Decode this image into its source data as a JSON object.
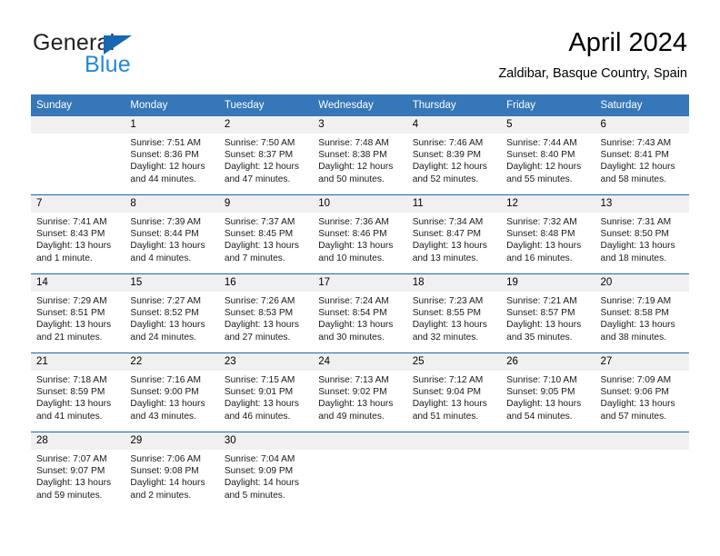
{
  "brand": {
    "name_part1": "General",
    "name_part2": "Blue",
    "logo_icon": "triangle-logo",
    "accent_blue": "#2489d4",
    "logo_blue": "#1668b3"
  },
  "header": {
    "title": "April 2024",
    "subtitle": "Zaldibar, Basque Country, Spain"
  },
  "calendar": {
    "header_bg": "#3577b8",
    "daynum_bg": "#f0f0f0",
    "separator_color": "#1668b3",
    "weekdays": [
      "Sunday",
      "Monday",
      "Tuesday",
      "Wednesday",
      "Thursday",
      "Friday",
      "Saturday"
    ],
    "weeks": [
      [
        {
          "day": "",
          "sunrise": "",
          "sunset": "",
          "daylight1": "",
          "daylight2": "",
          "empty": true
        },
        {
          "day": "1",
          "sunrise": "Sunrise: 7:51 AM",
          "sunset": "Sunset: 8:36 PM",
          "daylight1": "Daylight: 12 hours",
          "daylight2": "and 44 minutes."
        },
        {
          "day": "2",
          "sunrise": "Sunrise: 7:50 AM",
          "sunset": "Sunset: 8:37 PM",
          "daylight1": "Daylight: 12 hours",
          "daylight2": "and 47 minutes."
        },
        {
          "day": "3",
          "sunrise": "Sunrise: 7:48 AM",
          "sunset": "Sunset: 8:38 PM",
          "daylight1": "Daylight: 12 hours",
          "daylight2": "and 50 minutes."
        },
        {
          "day": "4",
          "sunrise": "Sunrise: 7:46 AM",
          "sunset": "Sunset: 8:39 PM",
          "daylight1": "Daylight: 12 hours",
          "daylight2": "and 52 minutes."
        },
        {
          "day": "5",
          "sunrise": "Sunrise: 7:44 AM",
          "sunset": "Sunset: 8:40 PM",
          "daylight1": "Daylight: 12 hours",
          "daylight2": "and 55 minutes."
        },
        {
          "day": "6",
          "sunrise": "Sunrise: 7:43 AM",
          "sunset": "Sunset: 8:41 PM",
          "daylight1": "Daylight: 12 hours",
          "daylight2": "and 58 minutes."
        }
      ],
      [
        {
          "day": "7",
          "sunrise": "Sunrise: 7:41 AM",
          "sunset": "Sunset: 8:43 PM",
          "daylight1": "Daylight: 13 hours",
          "daylight2": "and 1 minute."
        },
        {
          "day": "8",
          "sunrise": "Sunrise: 7:39 AM",
          "sunset": "Sunset: 8:44 PM",
          "daylight1": "Daylight: 13 hours",
          "daylight2": "and 4 minutes."
        },
        {
          "day": "9",
          "sunrise": "Sunrise: 7:37 AM",
          "sunset": "Sunset: 8:45 PM",
          "daylight1": "Daylight: 13 hours",
          "daylight2": "and 7 minutes."
        },
        {
          "day": "10",
          "sunrise": "Sunrise: 7:36 AM",
          "sunset": "Sunset: 8:46 PM",
          "daylight1": "Daylight: 13 hours",
          "daylight2": "and 10 minutes."
        },
        {
          "day": "11",
          "sunrise": "Sunrise: 7:34 AM",
          "sunset": "Sunset: 8:47 PM",
          "daylight1": "Daylight: 13 hours",
          "daylight2": "and 13 minutes."
        },
        {
          "day": "12",
          "sunrise": "Sunrise: 7:32 AM",
          "sunset": "Sunset: 8:48 PM",
          "daylight1": "Daylight: 13 hours",
          "daylight2": "and 16 minutes."
        },
        {
          "day": "13",
          "sunrise": "Sunrise: 7:31 AM",
          "sunset": "Sunset: 8:50 PM",
          "daylight1": "Daylight: 13 hours",
          "daylight2": "and 18 minutes."
        }
      ],
      [
        {
          "day": "14",
          "sunrise": "Sunrise: 7:29 AM",
          "sunset": "Sunset: 8:51 PM",
          "daylight1": "Daylight: 13 hours",
          "daylight2": "and 21 minutes."
        },
        {
          "day": "15",
          "sunrise": "Sunrise: 7:27 AM",
          "sunset": "Sunset: 8:52 PM",
          "daylight1": "Daylight: 13 hours",
          "daylight2": "and 24 minutes."
        },
        {
          "day": "16",
          "sunrise": "Sunrise: 7:26 AM",
          "sunset": "Sunset: 8:53 PM",
          "daylight1": "Daylight: 13 hours",
          "daylight2": "and 27 minutes."
        },
        {
          "day": "17",
          "sunrise": "Sunrise: 7:24 AM",
          "sunset": "Sunset: 8:54 PM",
          "daylight1": "Daylight: 13 hours",
          "daylight2": "and 30 minutes."
        },
        {
          "day": "18",
          "sunrise": "Sunrise: 7:23 AM",
          "sunset": "Sunset: 8:55 PM",
          "daylight1": "Daylight: 13 hours",
          "daylight2": "and 32 minutes."
        },
        {
          "day": "19",
          "sunrise": "Sunrise: 7:21 AM",
          "sunset": "Sunset: 8:57 PM",
          "daylight1": "Daylight: 13 hours",
          "daylight2": "and 35 minutes."
        },
        {
          "day": "20",
          "sunrise": "Sunrise: 7:19 AM",
          "sunset": "Sunset: 8:58 PM",
          "daylight1": "Daylight: 13 hours",
          "daylight2": "and 38 minutes."
        }
      ],
      [
        {
          "day": "21",
          "sunrise": "Sunrise: 7:18 AM",
          "sunset": "Sunset: 8:59 PM",
          "daylight1": "Daylight: 13 hours",
          "daylight2": "and 41 minutes."
        },
        {
          "day": "22",
          "sunrise": "Sunrise: 7:16 AM",
          "sunset": "Sunset: 9:00 PM",
          "daylight1": "Daylight: 13 hours",
          "daylight2": "and 43 minutes."
        },
        {
          "day": "23",
          "sunrise": "Sunrise: 7:15 AM",
          "sunset": "Sunset: 9:01 PM",
          "daylight1": "Daylight: 13 hours",
          "daylight2": "and 46 minutes."
        },
        {
          "day": "24",
          "sunrise": "Sunrise: 7:13 AM",
          "sunset": "Sunset: 9:02 PM",
          "daylight1": "Daylight: 13 hours",
          "daylight2": "and 49 minutes."
        },
        {
          "day": "25",
          "sunrise": "Sunrise: 7:12 AM",
          "sunset": "Sunset: 9:04 PM",
          "daylight1": "Daylight: 13 hours",
          "daylight2": "and 51 minutes."
        },
        {
          "day": "26",
          "sunrise": "Sunrise: 7:10 AM",
          "sunset": "Sunset: 9:05 PM",
          "daylight1": "Daylight: 13 hours",
          "daylight2": "and 54 minutes."
        },
        {
          "day": "27",
          "sunrise": "Sunrise: 7:09 AM",
          "sunset": "Sunset: 9:06 PM",
          "daylight1": "Daylight: 13 hours",
          "daylight2": "and 57 minutes."
        }
      ],
      [
        {
          "day": "28",
          "sunrise": "Sunrise: 7:07 AM",
          "sunset": "Sunset: 9:07 PM",
          "daylight1": "Daylight: 13 hours",
          "daylight2": "and 59 minutes."
        },
        {
          "day": "29",
          "sunrise": "Sunrise: 7:06 AM",
          "sunset": "Sunset: 9:08 PM",
          "daylight1": "Daylight: 14 hours",
          "daylight2": "and 2 minutes."
        },
        {
          "day": "30",
          "sunrise": "Sunrise: 7:04 AM",
          "sunset": "Sunset: 9:09 PM",
          "daylight1": "Daylight: 14 hours",
          "daylight2": "and 5 minutes."
        },
        {
          "day": "",
          "sunrise": "",
          "sunset": "",
          "daylight1": "",
          "daylight2": "",
          "empty": true
        },
        {
          "day": "",
          "sunrise": "",
          "sunset": "",
          "daylight1": "",
          "daylight2": "",
          "empty": true
        },
        {
          "day": "",
          "sunrise": "",
          "sunset": "",
          "daylight1": "",
          "daylight2": "",
          "empty": true
        },
        {
          "day": "",
          "sunrise": "",
          "sunset": "",
          "daylight1": "",
          "daylight2": "",
          "empty": true
        }
      ]
    ]
  }
}
